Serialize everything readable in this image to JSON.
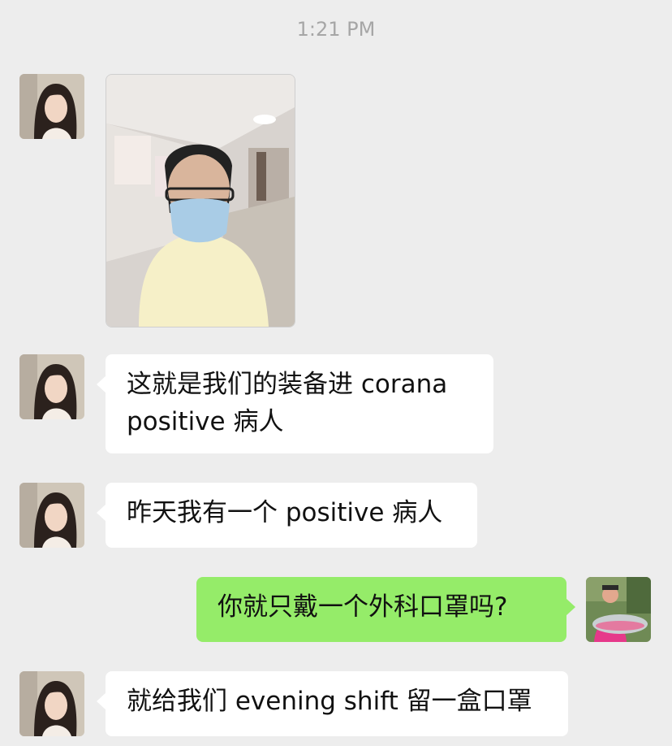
{
  "chat": {
    "timestamp": "1:21 PM",
    "contact_avatar_icon": "contact-avatar-woman-portrait",
    "self_avatar_icon": "self-avatar-man-with-fish",
    "photo_message_icon": "selfie-in-protective-gear-photo",
    "messages": [
      {
        "sender": "contact",
        "text": "这就是我们的装备进 corana positive 病人"
      },
      {
        "sender": "contact",
        "text": "昨天我有一个 positive 病人"
      },
      {
        "sender": "me",
        "text": "你就只戴一个外科口罩吗?"
      },
      {
        "sender": "contact",
        "text": "就给我们 evening shift 留一盒口罩"
      }
    ]
  },
  "colors": {
    "background": "#ededed",
    "incoming_bubble": "#ffffff",
    "outgoing_bubble": "#95ec69",
    "timestamp_text": "#a6a6a6"
  }
}
